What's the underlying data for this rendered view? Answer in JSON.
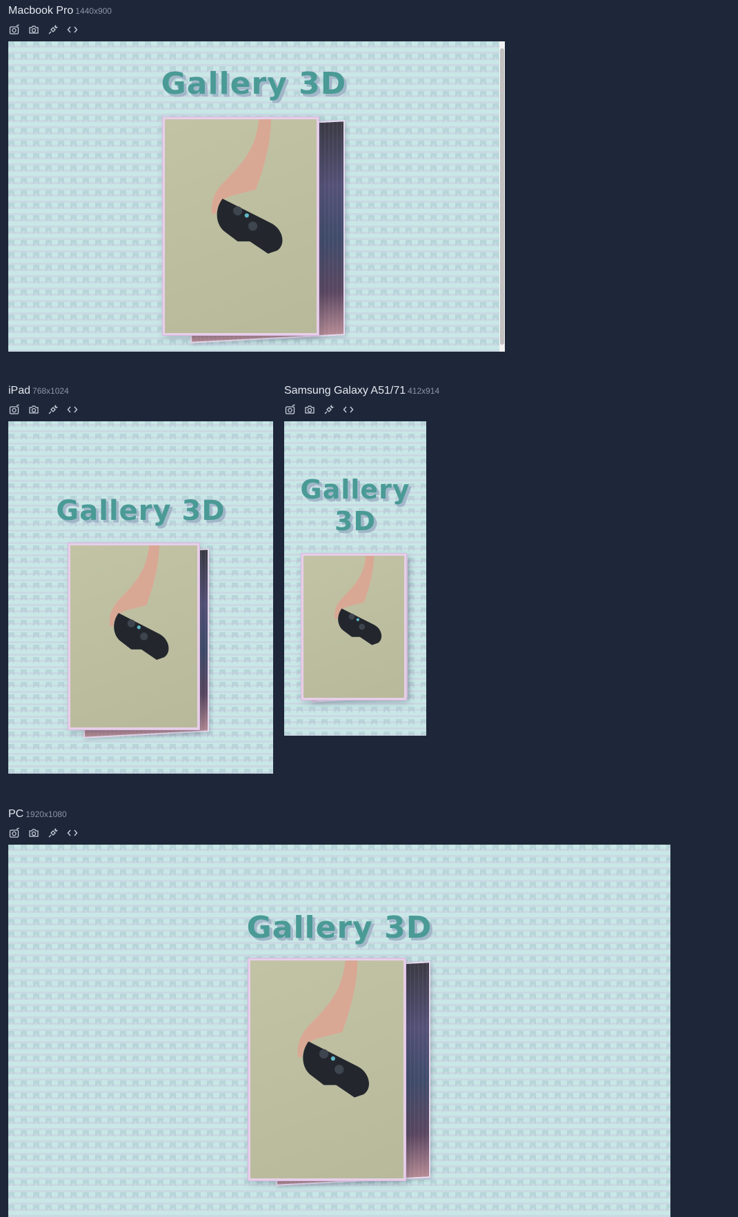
{
  "devices": [
    {
      "name": "Macbook Pro",
      "resolution": "1440x900"
    },
    {
      "name": "iPad",
      "resolution": "768x1024"
    },
    {
      "name": "Samsung Galaxy A51/71",
      "resolution": "412x914"
    },
    {
      "name": "PC",
      "resolution": "1920x1080"
    }
  ],
  "page": {
    "title": "Gallery 3D",
    "title_line1": "Gallery",
    "title_line2": "3D"
  },
  "toolbar": {
    "icons": [
      "camera-rotate-icon",
      "camera-icon",
      "plug-icon",
      "code-icon"
    ]
  },
  "colors": {
    "page_background": "#1e2739",
    "title": "#4a9a96",
    "card_border": "#e6cfe8"
  }
}
